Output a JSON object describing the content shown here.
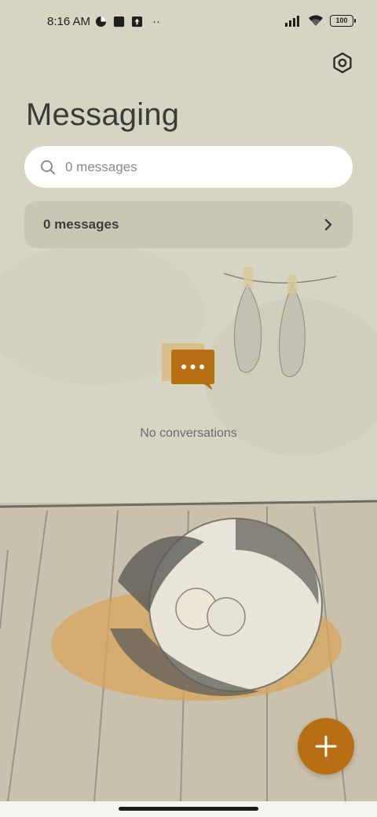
{
  "status_bar": {
    "time": "8:16 AM",
    "battery": "100",
    "left_icons": [
      "data-saver-icon",
      "square-notification-icon",
      "upload-notification-icon",
      "more-dots-icon"
    ],
    "right_icons": [
      "signal-icon",
      "wifi-icon",
      "battery-icon"
    ],
    "more_dots": "··"
  },
  "header": {
    "title": "Messaging",
    "settings_icon": "settings-hexagon-icon"
  },
  "search": {
    "placeholder": "0 messages"
  },
  "summary": {
    "label": "0 messages"
  },
  "empty_state": {
    "icon": "chat-bubbles-icon",
    "text": "No conversations"
  },
  "fab": {
    "icon": "plus-icon"
  },
  "colors": {
    "accent": "#b86e12",
    "background": "#d5d3c1",
    "search_bg": "#ffffff"
  }
}
